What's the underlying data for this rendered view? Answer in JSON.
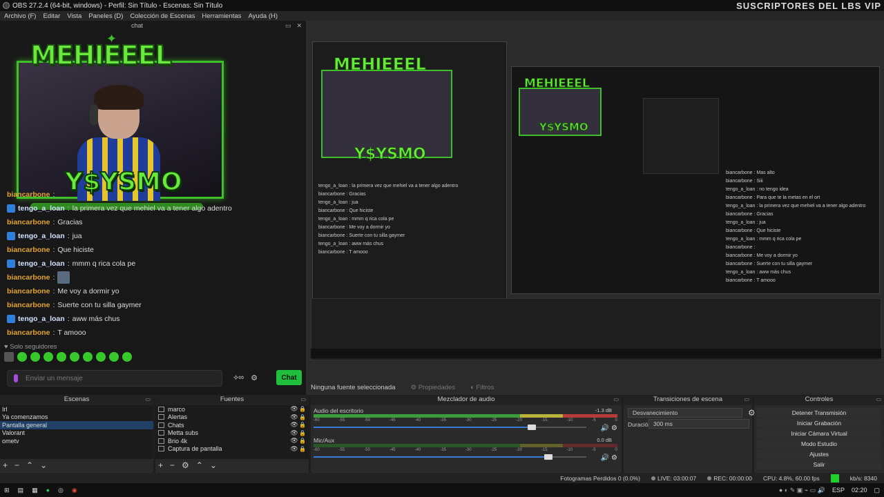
{
  "window": {
    "title": "OBS 27.2.4 (64-bit, windows) - Perfil: Sin Título - Escenas: Sin Título",
    "watermark": "SUSCRIPTORES DEL LBS VIP"
  },
  "menu": [
    "Archivo (F)",
    "Editar",
    "Vista",
    "Paneles (D)",
    "Colección de Escenas",
    "Herramientas",
    "Ayuda (H)"
  ],
  "chat_dock": {
    "title": "chat",
    "brand": "MEHIEEEL",
    "plate": "Y$YSMO",
    "messages": [
      {
        "user": "biancarbone",
        "kind": "orange",
        "badge": false,
        "text": ""
      },
      {
        "user": "tengo_a_loan",
        "kind": "blue",
        "badge": true,
        "text": "la primera vez que mehiel va a tener algo adentro"
      },
      {
        "user": "biancarbone",
        "kind": "orange",
        "badge": false,
        "text": "Gracias"
      },
      {
        "user": "tengo_a_loan",
        "kind": "blue",
        "badge": true,
        "text": "jua"
      },
      {
        "user": "biancarbone",
        "kind": "orange",
        "badge": false,
        "text": "Que hiciste"
      },
      {
        "user": "tengo_a_loan",
        "kind": "blue",
        "badge": true,
        "text": "mmm q rica cola pe"
      },
      {
        "user": "biancarbone",
        "kind": "orange",
        "badge": false,
        "text": "",
        "thumb": true
      },
      {
        "user": "biancarbone",
        "kind": "orange",
        "badge": false,
        "text": "Me voy a dormir yo"
      },
      {
        "user": "biancarbone",
        "kind": "orange",
        "badge": false,
        "text": "Suerte con tu silla gaymer"
      },
      {
        "user": "tengo_a_loan",
        "kind": "blue",
        "badge": true,
        "text": "aww más chus"
      },
      {
        "user": "biancarbone",
        "kind": "orange",
        "badge": false,
        "text": "T amooo"
      }
    ],
    "followers_label": "Solo seguidores",
    "input_placeholder": "Enviar un mensaje",
    "chat_button": "Chat"
  },
  "preview_status": {
    "no_source": "Ninguna fuente seleccionada",
    "properties": "Propiedades",
    "filters": "Filtros"
  },
  "scenes": {
    "title": "Escenas",
    "items": [
      "Irl",
      "Ya comenzamos",
      "Pantalla general",
      "Valorant",
      "ometv"
    ],
    "selected_index": 2
  },
  "sources": {
    "title": "Fuentes",
    "items": [
      "marco",
      "Alertas",
      "Chats",
      "Metta subs",
      "Brio 4k",
      "Captura de pantalla"
    ]
  },
  "mixer": {
    "title": "Mezclador de audio",
    "channels": [
      {
        "name": "Audio del escritorio",
        "db": "-1.3 dB",
        "volume": 0.8
      },
      {
        "name": "Mic/Aux",
        "db": "0.0 dB",
        "volume": 0.86
      }
    ],
    "ticks": [
      "-60",
      "-55",
      "-50",
      "-45",
      "-40",
      "-35",
      "-30",
      "-25",
      "-20",
      "-15",
      "-10",
      "-5",
      "0"
    ]
  },
  "transitions": {
    "title": "Transiciones de escena",
    "selected": "Desvanecimiento",
    "duration_label": "Duración",
    "duration_value": "300 ms"
  },
  "controls": {
    "title": "Controles",
    "buttons": [
      "Detener Transmisión",
      "Iniciar Grabación",
      "Iniciar Cámara Virtual",
      "Modo Estudio",
      "Ajustes",
      "Salir"
    ]
  },
  "status": {
    "dropped": "Fotogramas Perdidos 0 (0.0%)",
    "live": "LIVE: 03:00:07",
    "rec": "REC: 00:00:00",
    "cpu": "CPU: 4.8%, 60.00 fps",
    "kbps": "kb/s: 8340"
  },
  "taskbar": {
    "lang": "ESP",
    "time": "02:20"
  },
  "nested_chat": [
    "biancarbone : Mas alto",
    "biancarbone : Siii",
    "tengo_a_loan : no tengo idea",
    "biancarbone : Para que te la metas en el ort",
    "tengo_a_loan : la primera vez que mehiel va a tener algo adentro",
    "biancarbone : Gracias",
    "tengo_a_loan : jua",
    "biancarbone : Que hiciste",
    "tengo_a_loan : mmm q rica cola pe",
    "biancarbone :",
    "biancarbone : Me voy a dormir yo",
    "biancarbone : Suerte con tu silla gaymer",
    "tengo_a_loan : aww más chus",
    "biancarbone : T amooo"
  ]
}
